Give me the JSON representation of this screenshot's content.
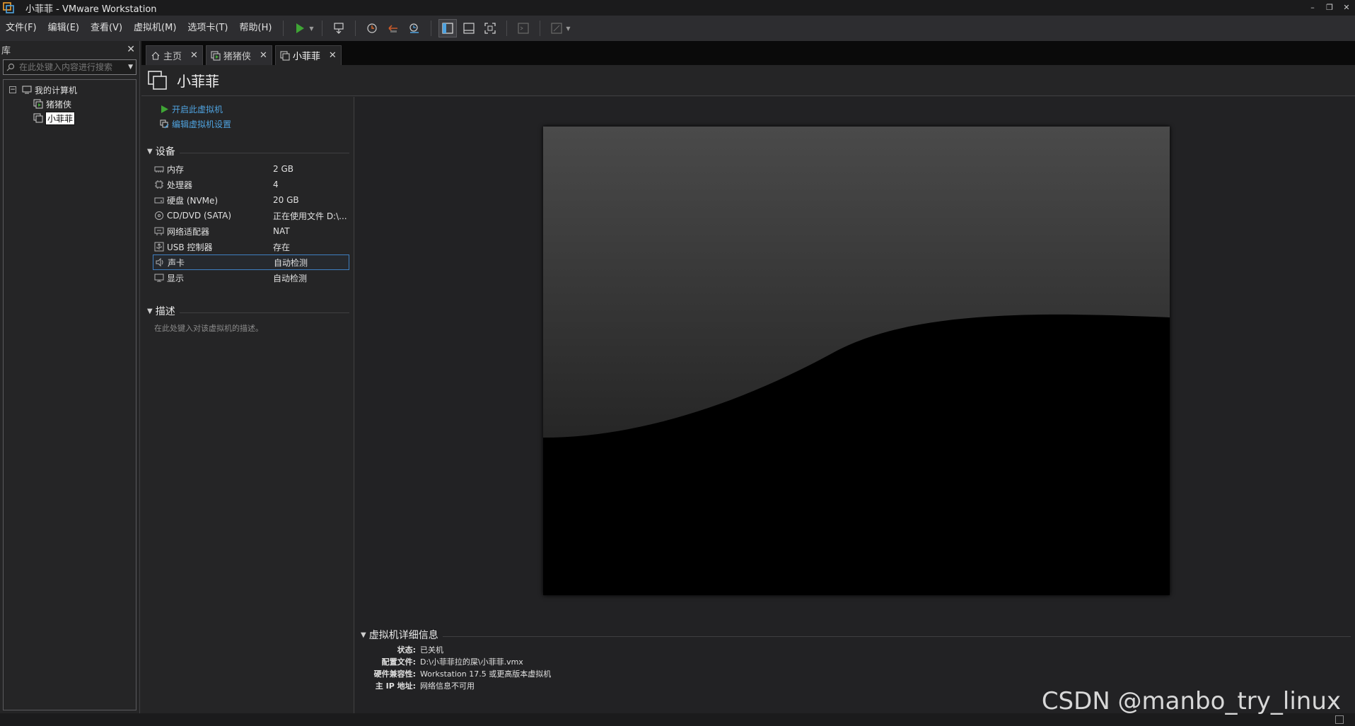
{
  "window": {
    "title": "小菲菲 - VMware Workstation",
    "controls": [
      "minimize",
      "restore",
      "close"
    ]
  },
  "menu": {
    "items": [
      "文件(F)",
      "编辑(E)",
      "查看(V)",
      "虚拟机(M)",
      "选项卡(T)",
      "帮助(H)"
    ]
  },
  "toolbar": {
    "icons": [
      "play-icon",
      "send-keys-icon",
      "snapshot-take-icon",
      "snapshot-revert-icon",
      "snapshot-manager-icon",
      "library-view-icon",
      "thumbnail-bar-icon",
      "fullscreen-icon",
      "console-view-icon",
      "unity-icon"
    ]
  },
  "library": {
    "title": "库",
    "search_placeholder": "在此处键入内容进行搜索",
    "root": "我的计算机",
    "vms": [
      "猪猪侠",
      "小菲菲"
    ],
    "selected_vm": "小菲菲"
  },
  "tabs": [
    {
      "label": "主页",
      "icon": "home-icon"
    },
    {
      "label": "猪猪侠",
      "icon": "vm-running-icon"
    },
    {
      "label": "小菲菲",
      "icon": "vm-icon",
      "active": true
    }
  ],
  "vm": {
    "name": "小菲菲",
    "actions": {
      "power_on": "开启此虚拟机",
      "edit_settings": "编辑虚拟机设置"
    },
    "devices_title": "设备",
    "devices": [
      {
        "name": "内存",
        "value": "2 GB",
        "icon": "memory-icon"
      },
      {
        "name": "处理器",
        "value": "4",
        "icon": "cpu-icon"
      },
      {
        "name": "硬盘 (NVMe)",
        "value": "20 GB",
        "icon": "harddisk-icon"
      },
      {
        "name": "CD/DVD (SATA)",
        "value": "正在使用文件 D:\\...",
        "icon": "cdrom-icon"
      },
      {
        "name": "网络适配器",
        "value": "NAT",
        "icon": "network-icon"
      },
      {
        "name": "USB 控制器",
        "value": "存在",
        "icon": "usb-icon"
      },
      {
        "name": "声卡",
        "value": "自动检测",
        "icon": "sound-icon",
        "selected": true
      },
      {
        "name": "显示",
        "value": "自动检测",
        "icon": "display-icon"
      }
    ],
    "description_title": "描述",
    "description_placeholder": "在此处键入对该虚拟机的描述。",
    "details_title": "虚拟机详细信息",
    "details": [
      {
        "key": "状态:",
        "value": "已关机"
      },
      {
        "key": "配置文件:",
        "value": "D:\\小菲菲拉的屎\\小菲菲.vmx"
      },
      {
        "key": "硬件兼容性:",
        "value": "Workstation 17.5 或更高版本虚拟机"
      },
      {
        "key": "主 IP 地址:",
        "value": "网络信息不可用"
      }
    ]
  },
  "watermark": "CSDN @manbo_try_linux",
  "colors": {
    "accent_link": "#4fa3e0",
    "play_green": "#3fa535",
    "selection_border": "#3e7fc1"
  }
}
